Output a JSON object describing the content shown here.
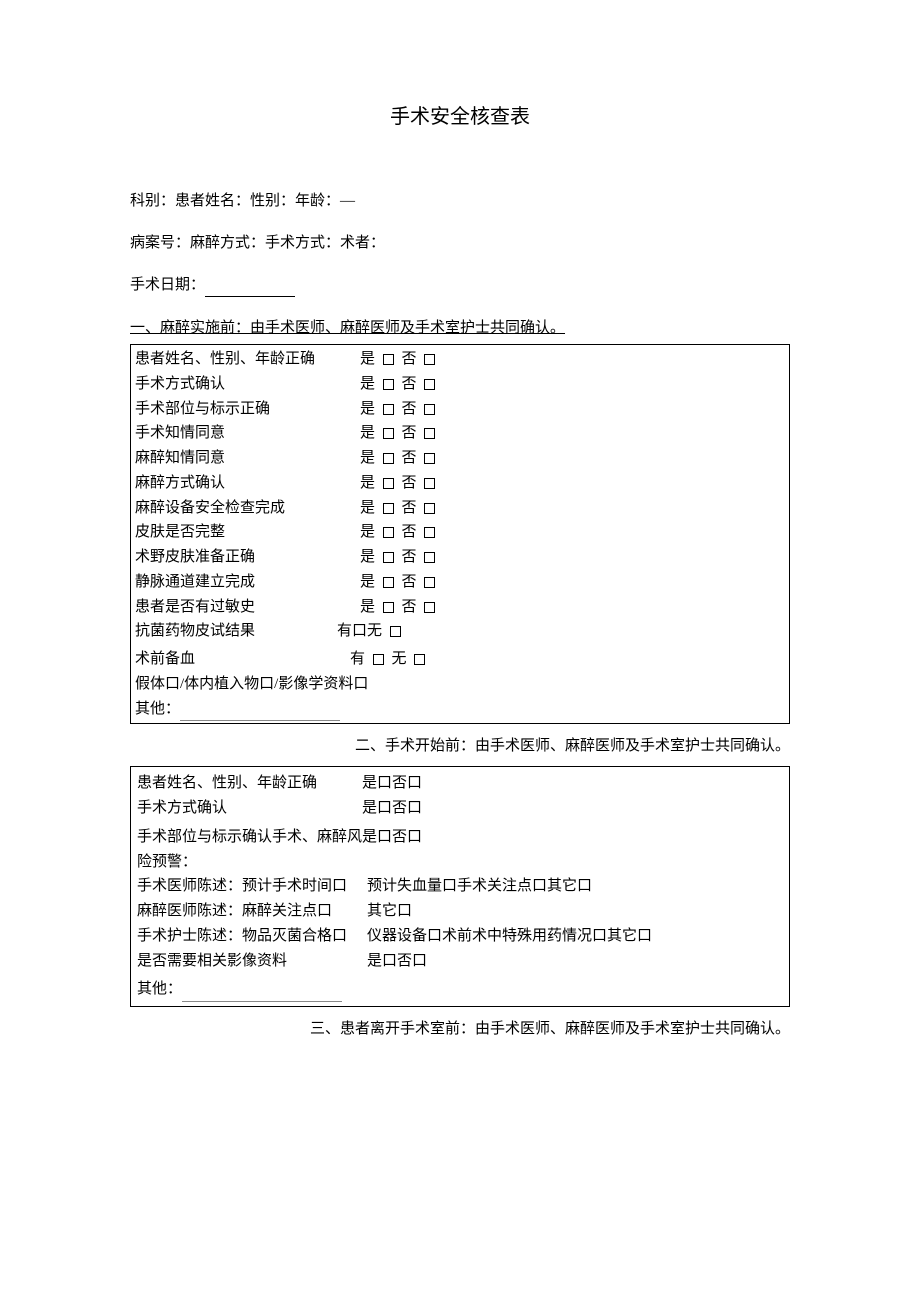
{
  "title": "手术安全核查表",
  "header": {
    "line1": "科别：患者姓名：性别：年龄：—",
    "line2": "病案号：麻醉方式：手术方式：术者：",
    "line3_label": "手术日期："
  },
  "section1": {
    "heading": "一、麻醉实施前：由手术医师、麻醉医师及手术室护士共同确认。",
    "rows": [
      {
        "label": "患者姓名、性别、年龄正确",
        "opt1": "是",
        "opt2": "否"
      },
      {
        "label": "手术方式确认",
        "opt1": "是",
        "opt2": "否"
      },
      {
        "label": "手术部位与标示正确",
        "opt1": "是",
        "opt2": "否"
      },
      {
        "label": "手术知情同意",
        "opt1": "是",
        "opt2": "否"
      },
      {
        "label": "麻醉知情同意",
        "opt1": "是",
        "opt2": "否"
      },
      {
        "label": "麻醉方式确认",
        "opt1": "是",
        "opt2": "否"
      },
      {
        "label": "麻醉设备安全检查完成",
        "opt1": "是",
        "opt2": "否"
      },
      {
        "label": "皮肤是否完整",
        "opt1": "是",
        "opt2": "否"
      },
      {
        "label": "术野皮肤准备正确",
        "opt1": "是",
        "opt2": "否"
      },
      {
        "label": "静脉通道建立完成",
        "opt1": "是",
        "opt2": "否"
      },
      {
        "label": "患者是否有过敏史",
        "opt1": "是",
        "opt2": "否"
      }
    ],
    "row_skin_test": {
      "label": "抗菌药物皮试结果",
      "opt": "有口无"
    },
    "row_blood": {
      "label": "术前备血",
      "opt1": "有",
      "opt2": "无"
    },
    "row_implant": "假体口/体内植入物口/影像学资料口",
    "row_other": "其他："
  },
  "section2": {
    "heading": "二、手术开始前：由手术医师、麻醉医师及手术室护士共同确认。",
    "rows": [
      {
        "label": "患者姓名、性别、年龄正确",
        "opt": "是口否口"
      },
      {
        "label": "手术方式确认",
        "opt": "是口否口"
      }
    ],
    "row_risk_label": "手术部位与标示确认手术、麻醉风",
    "row_risk_opt": "是口否口",
    "row_risk_cont": "险预警：",
    "row_surgeon": {
      "label": "手术医师陈述：预计手术时间口",
      "opt": "预计失血量口手术关注点口其它口"
    },
    "row_anesth": {
      "label": "麻醉医师陈述：麻醉关注点口",
      "opt": "其它口"
    },
    "row_nurse": {
      "label": "手术护士陈述：物品灭菌合格口",
      "opt": "仪器设备口术前术中特殊用药情况口其它口"
    },
    "row_image": {
      "label": "是否需要相关影像资料",
      "opt": "是口否口"
    },
    "row_other": "其他："
  },
  "section3": {
    "heading": "三、患者离开手术室前：由手术医师、麻醉医师及手术室护士共同确认。"
  }
}
